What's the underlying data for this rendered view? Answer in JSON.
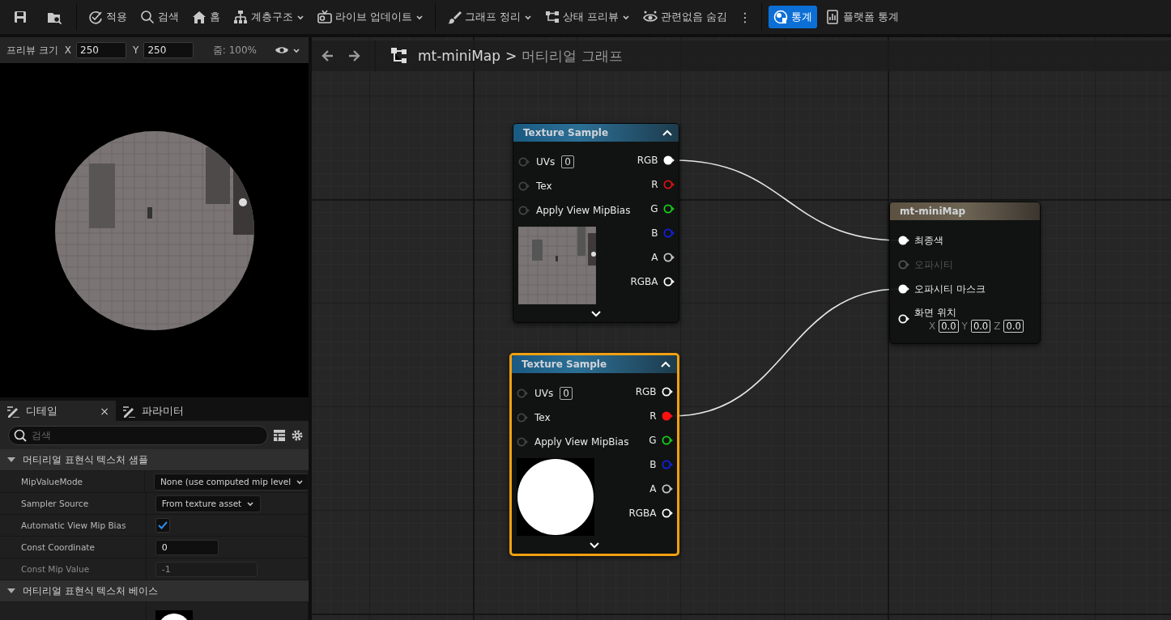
{
  "toolbar": {
    "items": [
      {
        "kind": "icon",
        "dropdown": false,
        "selected": false
      },
      {
        "kind": "icon",
        "dropdown": false,
        "selected": false
      },
      {
        "kind": "button",
        "label": "적용",
        "dropdown": false,
        "selected": false
      },
      {
        "kind": "button",
        "label": "검색",
        "dropdown": false,
        "selected": false
      },
      {
        "kind": "button",
        "label": "홈",
        "dropdown": false,
        "selected": false
      },
      {
        "kind": "button",
        "label": "계층구조",
        "dropdown": true,
        "selected": false
      },
      {
        "kind": "button",
        "label": "라이브 업데이트",
        "dropdown": true,
        "selected": false
      },
      {
        "kind": "button",
        "label": "그래프 정리",
        "dropdown": true,
        "selected": false
      },
      {
        "kind": "button",
        "label": "상태 프리뷰",
        "dropdown": true,
        "selected": false
      },
      {
        "kind": "button",
        "label": "관련없음 숨김",
        "dropdown": false,
        "selected": false
      },
      {
        "kind": "more",
        "label": "⋮",
        "dropdown": false,
        "selected": false
      },
      {
        "kind": "button",
        "label": "통계",
        "dropdown": false,
        "selected": true
      },
      {
        "kind": "button",
        "label": "플랫폼 통계",
        "dropdown": false,
        "selected": false
      }
    ]
  },
  "preview": {
    "size_label": "프리뷰 크기",
    "x_label": "X",
    "x_value": "250",
    "y_label": "Y",
    "y_value": "250",
    "zoom": "줌: 100%"
  },
  "details": {
    "tabs": [
      {
        "label": "디테일",
        "selected": true,
        "close": "×"
      },
      {
        "label": "파라미터",
        "selected": false
      }
    ],
    "search": {
      "placeholder": "검색"
    },
    "sections": [
      {
        "title": "머티리얼 표현식 텍스처 샘플",
        "expanded": true,
        "rows": [
          {
            "kind": "dropdown",
            "label": "MipValueMode",
            "value": "None (use computed mip level"
          },
          {
            "kind": "dropdown",
            "label": "Sampler Source",
            "value": "From texture asset"
          },
          {
            "kind": "checkbox",
            "label": "Automatic View Mip Bias",
            "checked": true
          },
          {
            "kind": "number",
            "label": "Const Coordinate",
            "value": "0",
            "disabled": false
          },
          {
            "kind": "number",
            "label": "Const Mip Value",
            "value": "-1",
            "disabled": true
          }
        ]
      },
      {
        "title": "머티리얼 표현식 텍스처 베이스",
        "expanded": true,
        "rows": [
          {
            "kind": "texture"
          }
        ]
      }
    ]
  },
  "graph": {
    "breadcrumb": {
      "asset": "mt-miniMap",
      "separator": ">",
      "page": "머티리얼 그래프"
    },
    "nodes": [
      {
        "kind": "texture-sample",
        "title": "Texture Sample",
        "selected": false,
        "preview": {
          "kind": "scene"
        },
        "inputs": [
          {
            "label": "UVs",
            "value": "0"
          },
          {
            "label": "Tex"
          },
          {
            "label": "Apply View MipBias"
          }
        ],
        "outputs": [
          {
            "label": "RGB",
            "color": "#ffffff",
            "connected": true
          },
          {
            "label": "R",
            "color": "#e01010",
            "connected": false
          },
          {
            "label": "G",
            "color": "#18d018",
            "connected": false
          },
          {
            "label": "B",
            "color": "#1020e0",
            "connected": false
          },
          {
            "label": "A",
            "color": "#c8c8c8",
            "connected": false
          },
          {
            "label": "RGBA",
            "color": "#ffffff",
            "connected": false
          }
        ]
      },
      {
        "kind": "texture-sample",
        "title": "Texture Sample",
        "selected": true,
        "preview": {
          "kind": "circle"
        },
        "inputs": [
          {
            "label": "UVs",
            "value": "0"
          },
          {
            "label": "Tex"
          },
          {
            "label": "Apply View MipBias"
          }
        ],
        "outputs": [
          {
            "label": "RGB",
            "color": "#ffffff",
            "connected": false
          },
          {
            "label": "R",
            "color": "#ff1010",
            "connected": true
          },
          {
            "label": "G",
            "color": "#18d018",
            "connected": false
          },
          {
            "label": "B",
            "color": "#1020e0",
            "connected": false
          },
          {
            "label": "A",
            "color": "#c8c8c8",
            "connected": false
          },
          {
            "label": "RGBA",
            "color": "#ffffff",
            "connected": false
          }
        ]
      },
      {
        "kind": "result",
        "title": "mt-miniMap",
        "selected": false,
        "pins": [
          {
            "label": "최종색",
            "connected": true,
            "disabled": false
          },
          {
            "label": "오파시티",
            "connected": false,
            "disabled": true
          },
          {
            "label": "오파시티 마스크",
            "connected": true,
            "disabled": false
          },
          {
            "label": "화면 위치",
            "connected": false,
            "disabled": false,
            "fields": [
              {
                "axis": "X",
                "value": "0.0"
              },
              {
                "axis": "Y",
                "value": "0.0"
              },
              {
                "axis": "Z",
                "value": "0.0"
              }
            ]
          }
        ]
      }
    ]
  }
}
